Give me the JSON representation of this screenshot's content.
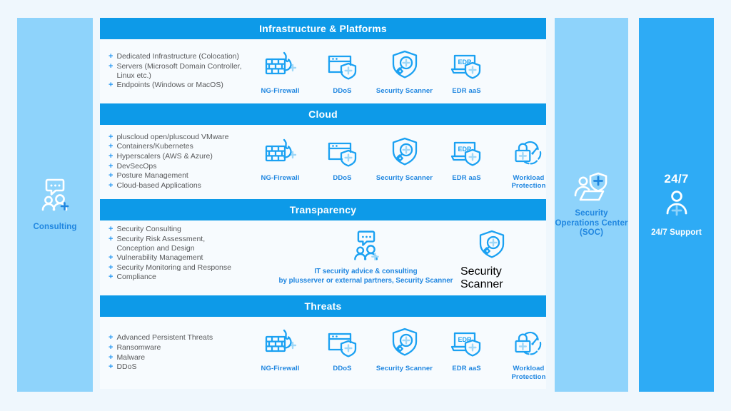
{
  "theme": {
    "page_bg": "#eff7fd",
    "panel_bg": "#f7fbfe",
    "header_blue": "#0d9ae8",
    "light_blue": "#8ed3fb",
    "mid_blue": "#2eabf5",
    "label_blue": "#1f86e0",
    "bullet_blue": "#2196f3",
    "text_gray": "#58595b"
  },
  "left_column": {
    "label": "Consulting",
    "icon": "consulting-people-chat-icon"
  },
  "sections": [
    {
      "title": "Infrastructure & Platforms",
      "bullets": [
        "Dedicated Infrastructure (Colocation)",
        "Servers (Microsoft Domain Controller, Linux etc.)",
        "Endpoints (Windows or MacOS)"
      ],
      "icons": [
        {
          "label": "NG-Firewall",
          "icon": "firewall-flame-icon"
        },
        {
          "label": "DDoS",
          "icon": "browser-shield-icon"
        },
        {
          "label": "Security Scanner",
          "icon": "shield-magnifier-icon"
        },
        {
          "label": "EDR aaS",
          "icon": "laptop-edr-shield-icon"
        }
      ]
    },
    {
      "title": "Cloud",
      "bullets": [
        "pluscloud open/pluscoud VMware",
        "Containers/Kubernetes",
        "Hyperscalers (AWS & Azure)",
        "DevSecOps",
        "Posture Management",
        "Cloud-based Applications"
      ],
      "icons": [
        {
          "label": "NG-Firewall",
          "icon": "firewall-flame-icon"
        },
        {
          "label": "DDoS",
          "icon": "browser-shield-icon"
        },
        {
          "label": "Security Scanner",
          "icon": "shield-magnifier-icon"
        },
        {
          "label": "EDR aaS",
          "icon": "laptop-edr-shield-icon"
        },
        {
          "label": "Workload Protection",
          "icon": "padlock-gauge-icon"
        }
      ]
    },
    {
      "title": "Transparency",
      "bullets": [
        "Security Consulting",
        "Security Risk Assessment, Conception and Design",
        "Vulnerability Management",
        "Security Monitoring and Response",
        "Compliance"
      ],
      "center_icon": "consulting-people-chat-icon",
      "center_caption_line1": "IT security advice & consulting",
      "center_caption_line2": "by plusserver or external partners, Security Scanner",
      "icons": [
        {
          "label": "Security Scanner",
          "icon": "shield-magnifier-icon"
        }
      ]
    },
    {
      "title": "Threats",
      "bullets": [
        "Advanced Persistent Threats",
        "Ransomware",
        "Malware",
        "DDoS"
      ],
      "icons": [
        {
          "label": "NG-Firewall",
          "icon": "firewall-flame-icon"
        },
        {
          "label": "DDoS",
          "icon": "browser-shield-icon"
        },
        {
          "label": "Security Scanner",
          "icon": "shield-magnifier-icon"
        },
        {
          "label": "EDR aaS",
          "icon": "laptop-edr-shield-icon"
        },
        {
          "label": "Workload Protection",
          "icon": "padlock-gauge-icon"
        }
      ]
    }
  ],
  "right_columns": [
    {
      "label": "Security Operations Center (SOC)",
      "icon": "soc-person-laptop-shield-icon"
    },
    {
      "headline": "24/7",
      "label": "24/7 Support",
      "icon": "person-plus-icon"
    }
  ],
  "icon_text": {
    "edr_badge": "EDR"
  }
}
